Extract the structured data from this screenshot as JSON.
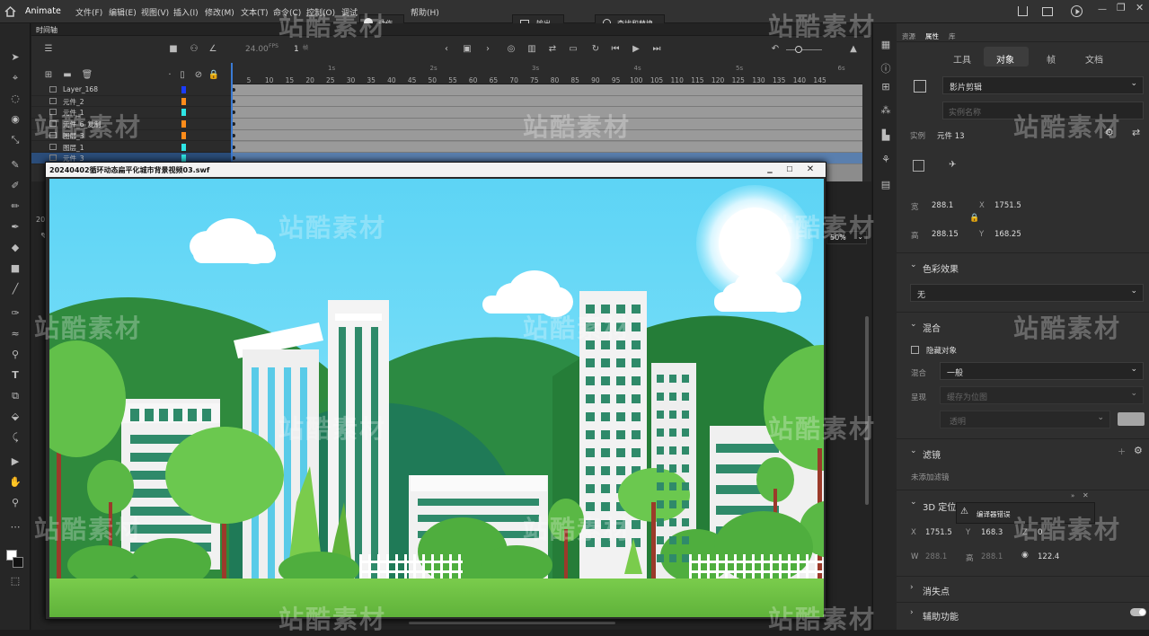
{
  "menubar": {
    "app_name": "Animate",
    "items": [
      "文件(F)",
      "编辑(E)",
      "视图(V)",
      "插入(I)",
      "修改(M)",
      "文本(T)",
      "命令(C)",
      "控制(O)",
      "调试",
      "帮助(H)"
    ],
    "panels": {
      "action": "动作",
      "output": "输出",
      "find_replace": "查找和替换"
    }
  },
  "timeline": {
    "tab_label": "时间轴",
    "fps": "24.00",
    "fps_unit": "FPS",
    "frame": "1",
    "frame_unit": "帧",
    "seconds": [
      "1s",
      "2s",
      "3s",
      "4s",
      "5s",
      "6s"
    ],
    "frame_numbers": [
      "5",
      "10",
      "15",
      "20",
      "25",
      "30",
      "35",
      "40",
      "45",
      "50",
      "55",
      "60",
      "65",
      "70",
      "75",
      "80",
      "85",
      "90",
      "95",
      "100",
      "105",
      "110",
      "115",
      "120",
      "125",
      "130",
      "135",
      "140",
      "145"
    ],
    "layers": [
      {
        "name": "Layer_168",
        "color": "#1a3cff"
      },
      {
        "name": "元件_2",
        "color": "#ff8c1a"
      },
      {
        "name": "元件_1",
        "color": "#2ee6e6"
      },
      {
        "name": "元件_6_复制",
        "color": "#ff8c1a"
      },
      {
        "name": "图层_3",
        "color": "#ff8c1a"
      },
      {
        "name": "图层_1",
        "color": "#2ee6e6"
      },
      {
        "name": "元件_3",
        "color": "#2ee6e6"
      }
    ],
    "zoom": "50%",
    "side_number": "20"
  },
  "swf_window": {
    "title": "20240402循环动态扁平化城市背景视频03.swf",
    "minimize": "▁",
    "maximize": "☐",
    "close": "✕"
  },
  "props": {
    "top_tabs": [
      "资源",
      "属性",
      "库"
    ],
    "sub_tabs": [
      "工具",
      "对象",
      "帧",
      "文档"
    ],
    "active_sub_tab": "对象",
    "symbol_type": "影片剪辑",
    "instance_placeholder": "实例名称",
    "instance_label": "实例",
    "instance_value": "元件 13",
    "width_label": "宽",
    "width": "288.1",
    "height_label": "高",
    "height": "288.15",
    "x_label": "X",
    "x": "1751.5",
    "y_label": "Y",
    "y": "168.25",
    "color_effect_title": "色彩效果",
    "color_effect_value": "无",
    "blend_title": "混合",
    "hide_object": "隐藏对象",
    "blend_label": "混合",
    "blend_value": "一般",
    "render_label": "呈现",
    "render_value": "缓存为位图",
    "transparent_value": "透明",
    "filter_title": "滤镜",
    "filter_empty": "未添加滤镜",
    "pos3d_title": "3D 定位",
    "error_badge": "编译器错误",
    "pos3d_x_label": "X",
    "pos3d_x": "1751.5",
    "pos3d_y_label": "Y",
    "pos3d_y": "168.3",
    "pos3d_z_label": "Z",
    "pos3d_z": "0",
    "w_label": "W",
    "w_value": "288.1",
    "h_label": "高",
    "h_value": "288.1",
    "persp_value": "122.4",
    "vanish_title": "消失点",
    "assist_title": "辅助功能"
  },
  "watermark": "站酷素材"
}
